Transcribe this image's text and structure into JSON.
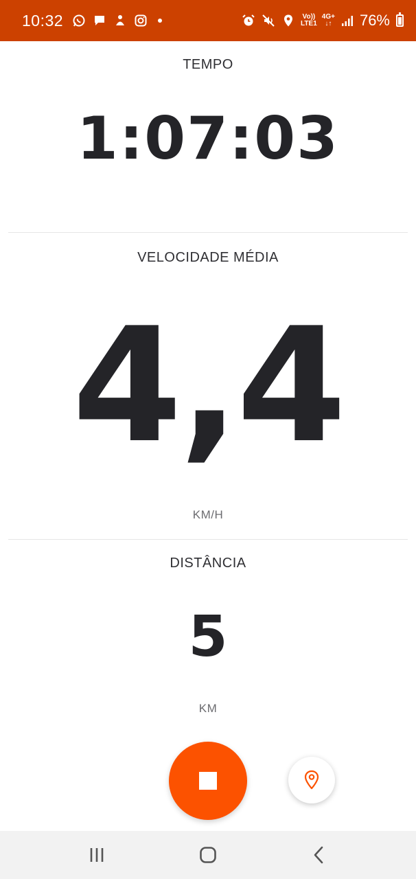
{
  "status_bar": {
    "time": "10:32",
    "network_top": "Vo))",
    "network_bottom": "LTE1",
    "network_type": "4G+",
    "battery": "76%",
    "icons": [
      "whatsapp-icon",
      "message-icon",
      "notification-icon",
      "instagram-icon",
      "alarm-icon",
      "mute-icon",
      "location-icon",
      "signal-icon",
      "battery-icon"
    ],
    "bg_color": "#cc4100"
  },
  "time_section": {
    "label": "TEMPO",
    "value": "1:07:03"
  },
  "speed_section": {
    "label": "VELOCIDADE MÉDIA",
    "value": "4,4",
    "unit": "KM/H"
  },
  "distance_section": {
    "label": "DISTÂNCIA",
    "value": "5",
    "unit": "KM"
  },
  "controls": {
    "stop_icon": "stop-icon",
    "location_icon": "map-pin-icon",
    "accent_color": "#fc5200"
  },
  "nav_bar": {
    "icons": [
      "recent-apps-icon",
      "home-icon",
      "back-icon"
    ]
  }
}
